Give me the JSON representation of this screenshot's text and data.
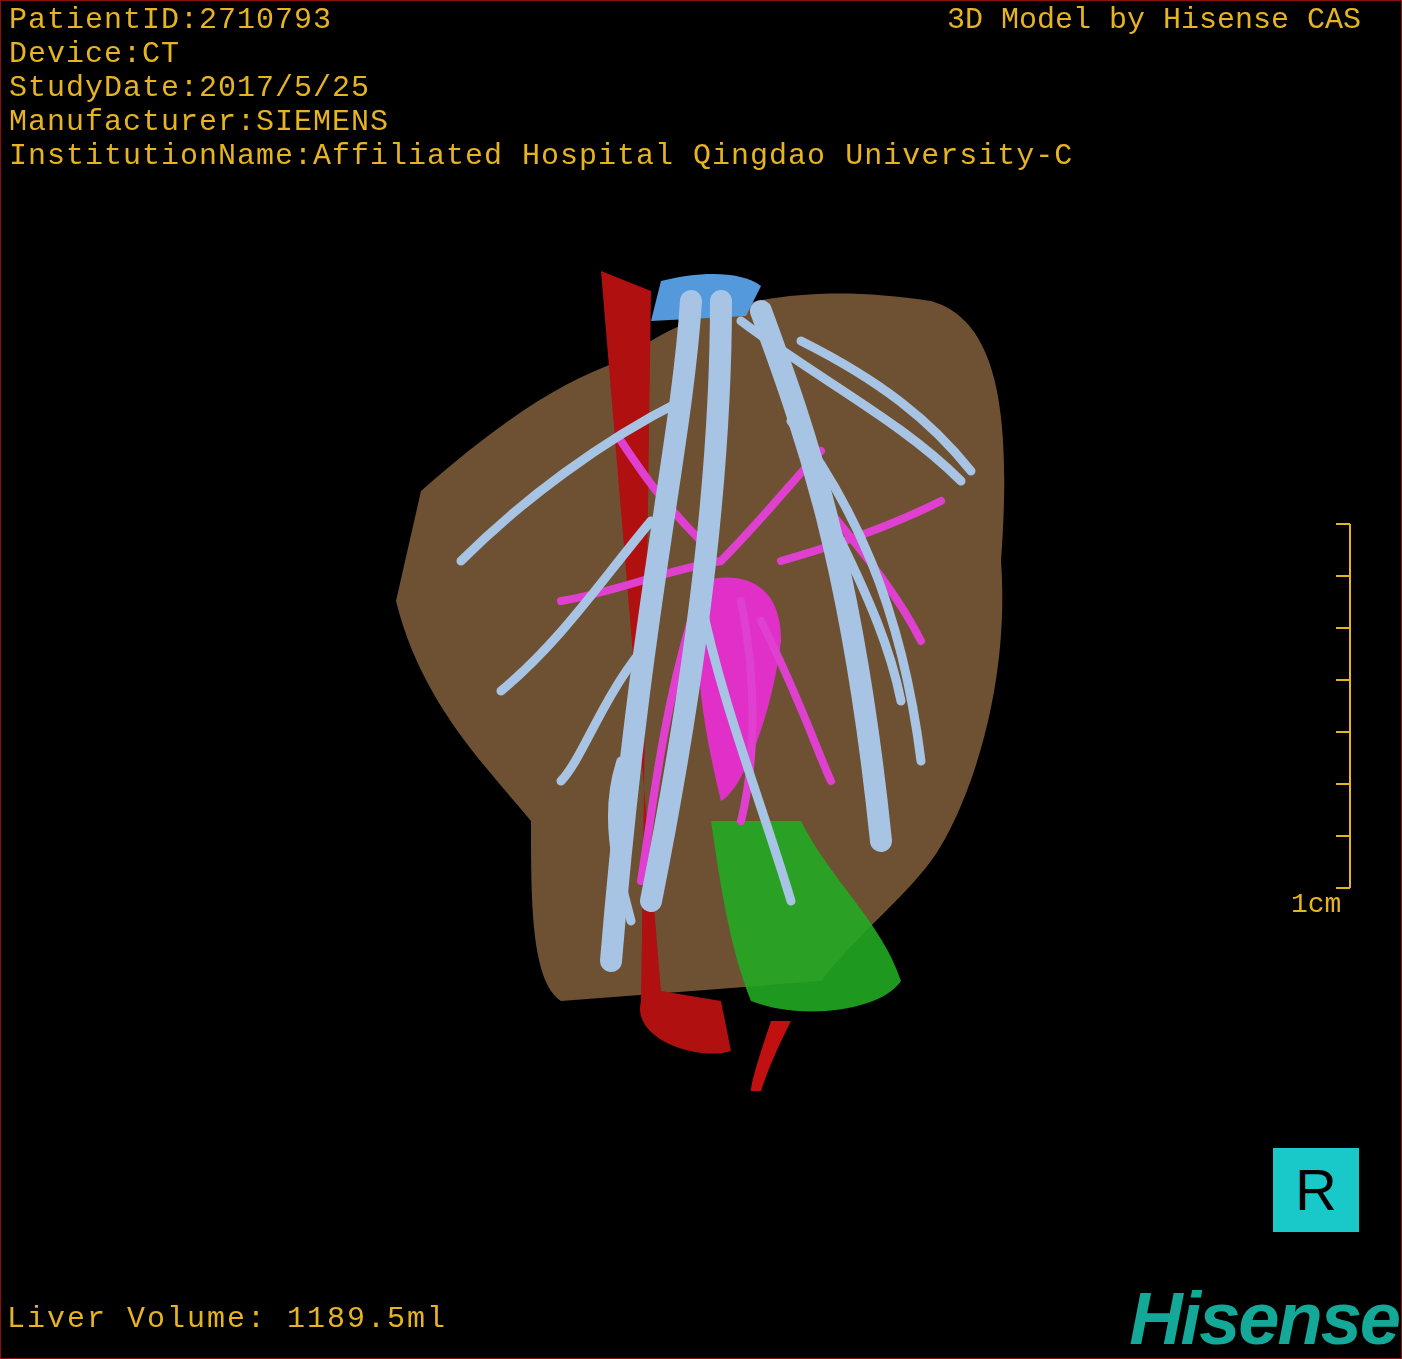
{
  "info_lines": [
    "PatientID:2710793",
    "Device:CT",
    "StudyDate:2017/5/25",
    "Manufacturer:SIEMENS",
    "InstitutionName:Affiliated Hospital Qingdao University-C"
  ],
  "credit": "3D Model by Hisense CAS",
  "scale_bar": {
    "label": "1cm"
  },
  "orientation_marker": "R",
  "volume": "Liver Volume: 1189.5ml",
  "logo": "Hisense"
}
